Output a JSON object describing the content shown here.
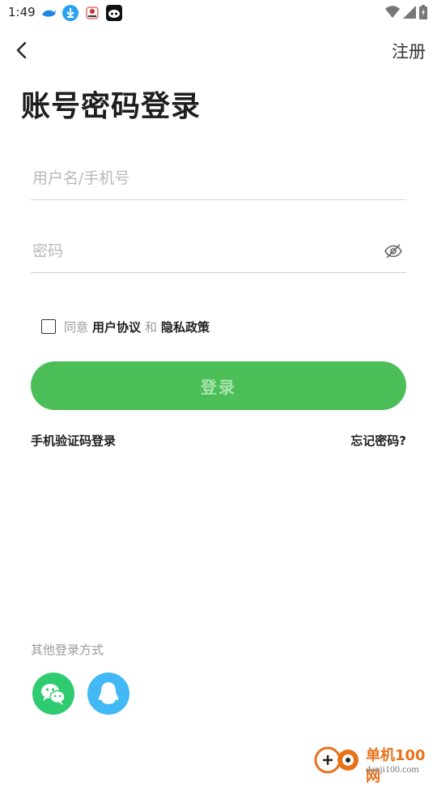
{
  "status_bar": {
    "time": "1:49",
    "icons": [
      "whale-app-icon",
      "download-icon",
      "game-app-icon",
      "robot-app-icon",
      "wifi-icon",
      "signal-icon",
      "battery-icon"
    ]
  },
  "header": {
    "register_label": "注册"
  },
  "title": "账号密码登录",
  "form": {
    "username_placeholder": "用户名/手机号",
    "username_value": "",
    "password_placeholder": "密码",
    "password_value": ""
  },
  "agreement": {
    "checked": false,
    "prefix": "同意",
    "user_agreement": "用户协议",
    "and": "和",
    "privacy_policy": "隐私政策"
  },
  "login_button": "登录",
  "links": {
    "sms_login": "手机验证码登录",
    "forgot_password": "忘记密码?"
  },
  "other_login": {
    "label": "其他登录方式",
    "methods": [
      "wechat-icon",
      "qq-icon"
    ]
  },
  "watermark": {
    "title": "单机100网",
    "url": "danji100.com"
  },
  "colors": {
    "accent": "#4cbe58",
    "button_text": "#a8e3ae",
    "wechat": "#2ecb71",
    "qq": "#42b8f5",
    "placeholder": "#b9b9b9"
  }
}
